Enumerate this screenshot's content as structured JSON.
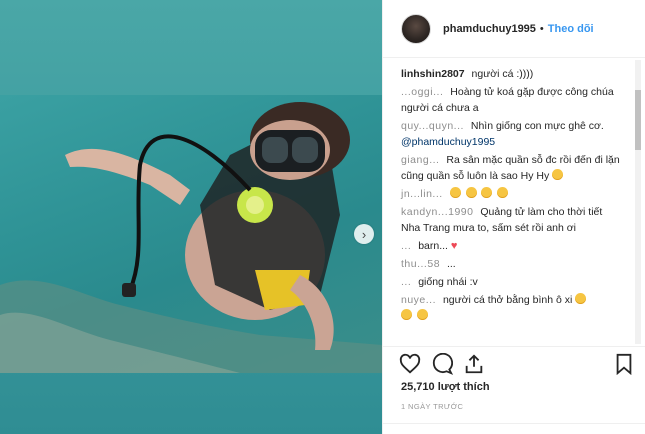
{
  "post": {
    "username": "phamduchuy1995",
    "separator": "•",
    "follow_label": "Theo dõi",
    "likes": "25,710 lượt thích",
    "time_ago": "1 NGÀY TRƯỚC"
  },
  "comments": [
    {
      "user": "linhshin2807",
      "text": "người cá :))))",
      "blurred": false
    },
    {
      "user": "...oggi...",
      "text": "Hoàng tử koá gặp được công chúa người cá chưa a",
      "blurred": true
    },
    {
      "user": "quy...quyn...",
      "text": "Nhìn giống con mực ghê cơ.",
      "mention": "@phamduchuy1995",
      "blurred": true
    },
    {
      "user": "giang...",
      "text": "Ra sân mặc quần sỗ đc rồi đến đi lặn cũng quần sỗ luôn là sao Hy Hy",
      "emoji_count": 1,
      "blurred": true
    },
    {
      "user": "jn...lin...",
      "text": "",
      "emoji_count": 4,
      "blurred": true
    },
    {
      "user": "kandyn...1990",
      "text": "Quảng tử làm cho thời tiết Nha Trang mưa to, sấm sét rồi anh ơi",
      "blurred": true
    },
    {
      "user": "...",
      "text": "barn...",
      "heart": true,
      "blurred": true
    },
    {
      "user": "thu...58",
      "text": "...",
      "blurred": true
    },
    {
      "user": "...",
      "text": "giống nhái :v",
      "blurred": true
    },
    {
      "user": "nuye...",
      "text": "người cá thở bằng bình ô xi",
      "emoji_count": 1,
      "trailing_emoji_count": 1,
      "blurred": true
    }
  ],
  "icons": {
    "like": "heart-outline-icon",
    "comment": "speech-bubble-icon",
    "share": "share-arrow-icon",
    "save": "bookmark-icon",
    "next": "chevron-right-icon"
  },
  "colors": {
    "link": "#3897f0",
    "text": "#262626",
    "water": "#3aa0a2"
  }
}
